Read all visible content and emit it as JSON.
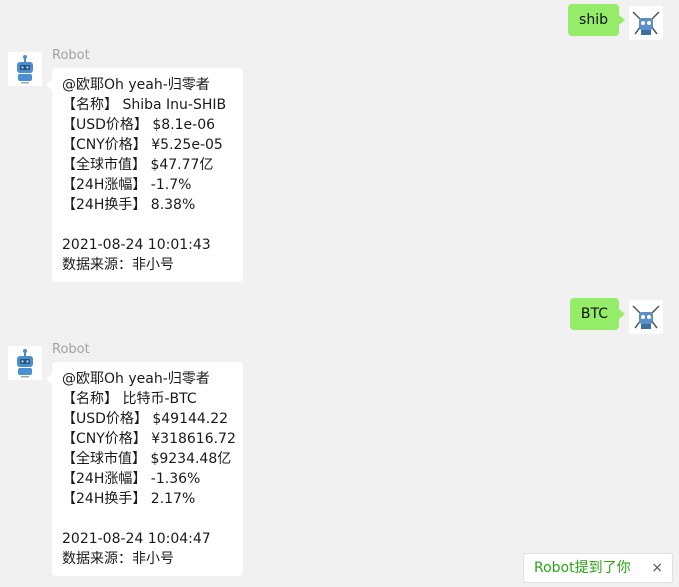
{
  "colors": {
    "background": "#f1f1f1",
    "outgoing_bubble": "#95ec69",
    "incoming_bubble": "#ffffff",
    "sender_name": "#a2a2a2",
    "mention_text": "#2aa515"
  },
  "messages": [
    {
      "direction": "out",
      "text": "shib"
    },
    {
      "direction": "in",
      "sender": "Robot",
      "lines": [
        "@欧耶Oh yeah-归零者",
        "【名称】 Shiba Inu-SHIB",
        "【USD价格】 $8.1e-06",
        "【CNY价格】 ¥5.25e-05",
        "【全球市值】 $47.77亿",
        "【24H涨幅】 -1.7%",
        "【24H换手】 8.38%",
        "",
        "2021-08-24 10:01:43",
        "数据来源：非小号"
      ]
    },
    {
      "direction": "out",
      "text": "BTC"
    },
    {
      "direction": "in",
      "sender": "Robot",
      "lines": [
        "@欧耶Oh yeah-归零者",
        "【名称】 比特币-BTC",
        "【USD价格】 $49144.22",
        "【CNY价格】 ¥318616.72",
        "【全球市值】 $9234.48亿",
        "【24H涨幅】 -1.36%",
        "【24H换手】 2.17%",
        "",
        "2021-08-24 10:04:47",
        "数据来源：非小号"
      ]
    }
  ],
  "mention_toast": {
    "text": "Robot提到了你",
    "close": "×"
  },
  "icons": {
    "robot_avatar": "robot-avatar-icon",
    "user_avatar": "user-avatar-icon",
    "close": "close-icon"
  }
}
